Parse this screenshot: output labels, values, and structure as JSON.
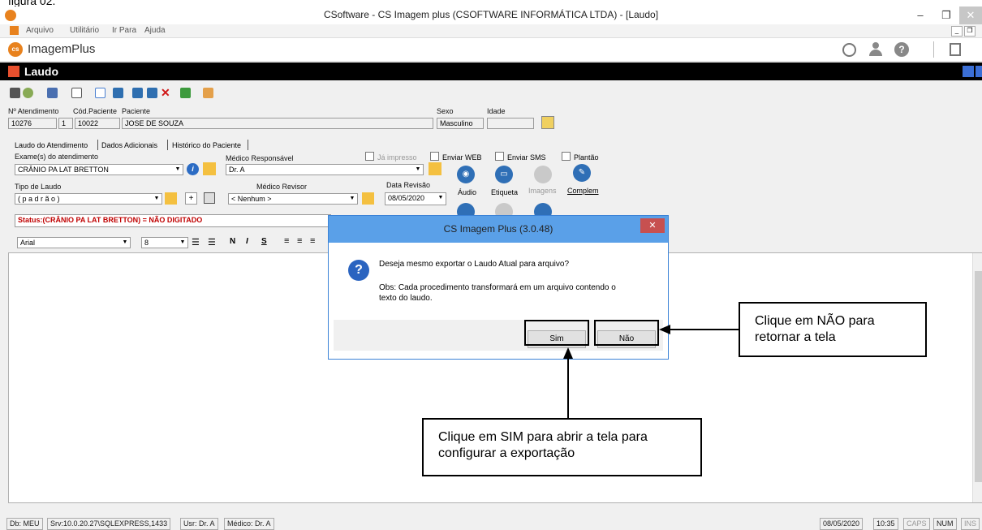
{
  "figure_caption": "figura 02.",
  "window": {
    "title": "CSoftware - CS Imagem plus (CSOFTWARE INFORMÁTICA LTDA) - [Laudo]",
    "minimize": "–",
    "restore": "❐",
    "close": "✕"
  },
  "menu": {
    "items": [
      "Arquivo",
      "Utilitário",
      "Ir Para",
      "Ajuda"
    ]
  },
  "brand": {
    "name": "ImagemPlus",
    "logo": "cs",
    "accent": "#e8821e"
  },
  "module": {
    "title": "Laudo"
  },
  "patient": {
    "labels": {
      "atendimento": "Nº Atendimento",
      "cod": "Cód.Paciente",
      "paciente": "Paciente",
      "sexo": "Sexo",
      "idade": "Idade"
    },
    "atendimento": "10276",
    "seq": "1",
    "cod": "10022",
    "nome": "JOSE DE SOUZA",
    "sexo": "Masculino",
    "idade": ""
  },
  "tabs": [
    "Laudo do Atendimento",
    "Dados Adicionais",
    "Histórico do Paciente"
  ],
  "form": {
    "exames_label": "Exame(s) do atendimento",
    "exame": "CRÂNIO PA LAT BRETTON",
    "medico_resp_label": "Médico Responsável",
    "medico_resp": "Dr. A",
    "tipo_label": "Tipo de Laudo",
    "tipo": "( p a d r ã o )",
    "medico_rev_label": "Médico Revisor",
    "medico_rev": "< Nenhum >",
    "data_rev_label": "Data Revisão",
    "data_rev": "08/05/2020",
    "plus": "+",
    "checks": {
      "impresso": "Já impresso",
      "web": "Enviar WEB",
      "sms": "Enviar SMS",
      "plantao": "Plantão"
    },
    "buttons": {
      "audio": "Áudio",
      "etiqueta": "Etiqueta",
      "imagens": "Imagens",
      "complem": "Complem"
    }
  },
  "status": "Status:(CRÂNIO PA LAT BRETTON) = NÃO DIGITADO",
  "format": {
    "font": "Arial",
    "size": "8",
    "bold": "N",
    "italic": "I",
    "underline": "S"
  },
  "dialog": {
    "title": "CS Imagem Plus (3.0.48)",
    "question": "Deseja mesmo exportar o Laudo Atual para arquivo?",
    "obs": "Obs: Cada procedimento transformará em um arquivo contendo o texto do laudo.",
    "yes": "Sim",
    "no": "Não"
  },
  "callouts": {
    "nao": "Clique em NÃO para retornar a tela",
    "sim": "Clique em SIM para abrir a tela para configurar a exportação"
  },
  "statusbar": {
    "db": "Db: MEU",
    "srv": "Srv:10.0.20.27\\SQLEXPRESS,1433",
    "usr": "Usr: Dr. A",
    "medico": "Médico: Dr. A",
    "date": "08/05/2020",
    "time": "10:35",
    "caps": "CAPS",
    "num": "NUM",
    "ins": "INS"
  }
}
